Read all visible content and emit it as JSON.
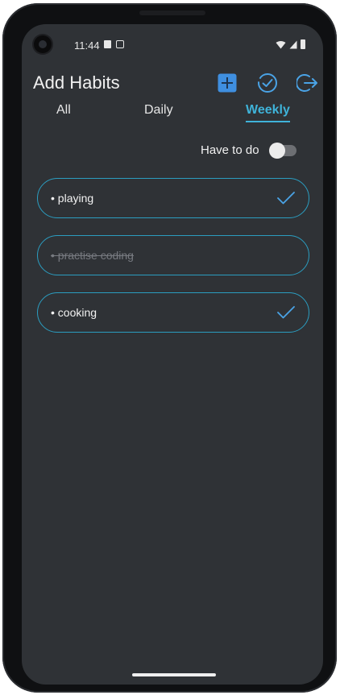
{
  "status_bar": {
    "time": "11:44",
    "icons": [
      "sim-card-icon",
      "screenshot-icon",
      "wifi-icon",
      "signal-icon",
      "battery-icon"
    ]
  },
  "header": {
    "title": "Add Habits",
    "actions": [
      {
        "name": "add-habit",
        "icon": "plus-square-icon"
      },
      {
        "name": "completed",
        "icon": "check-circle-icon"
      },
      {
        "name": "logout",
        "icon": "logout-icon"
      }
    ]
  },
  "tabs": {
    "all": "All",
    "daily": "Daily",
    "weekly": "Weekly",
    "selected": "Weekly"
  },
  "filter": {
    "label": "Have to do",
    "enabled": false
  },
  "habits": [
    {
      "text": "• playing",
      "completed": false
    },
    {
      "text": "• practise coding",
      "completed": true
    },
    {
      "text": "• cooking",
      "completed": false
    }
  ],
  "colors": {
    "background": "#2f3236",
    "accent": "#3fb3d9",
    "text": "#f2f2f2"
  }
}
